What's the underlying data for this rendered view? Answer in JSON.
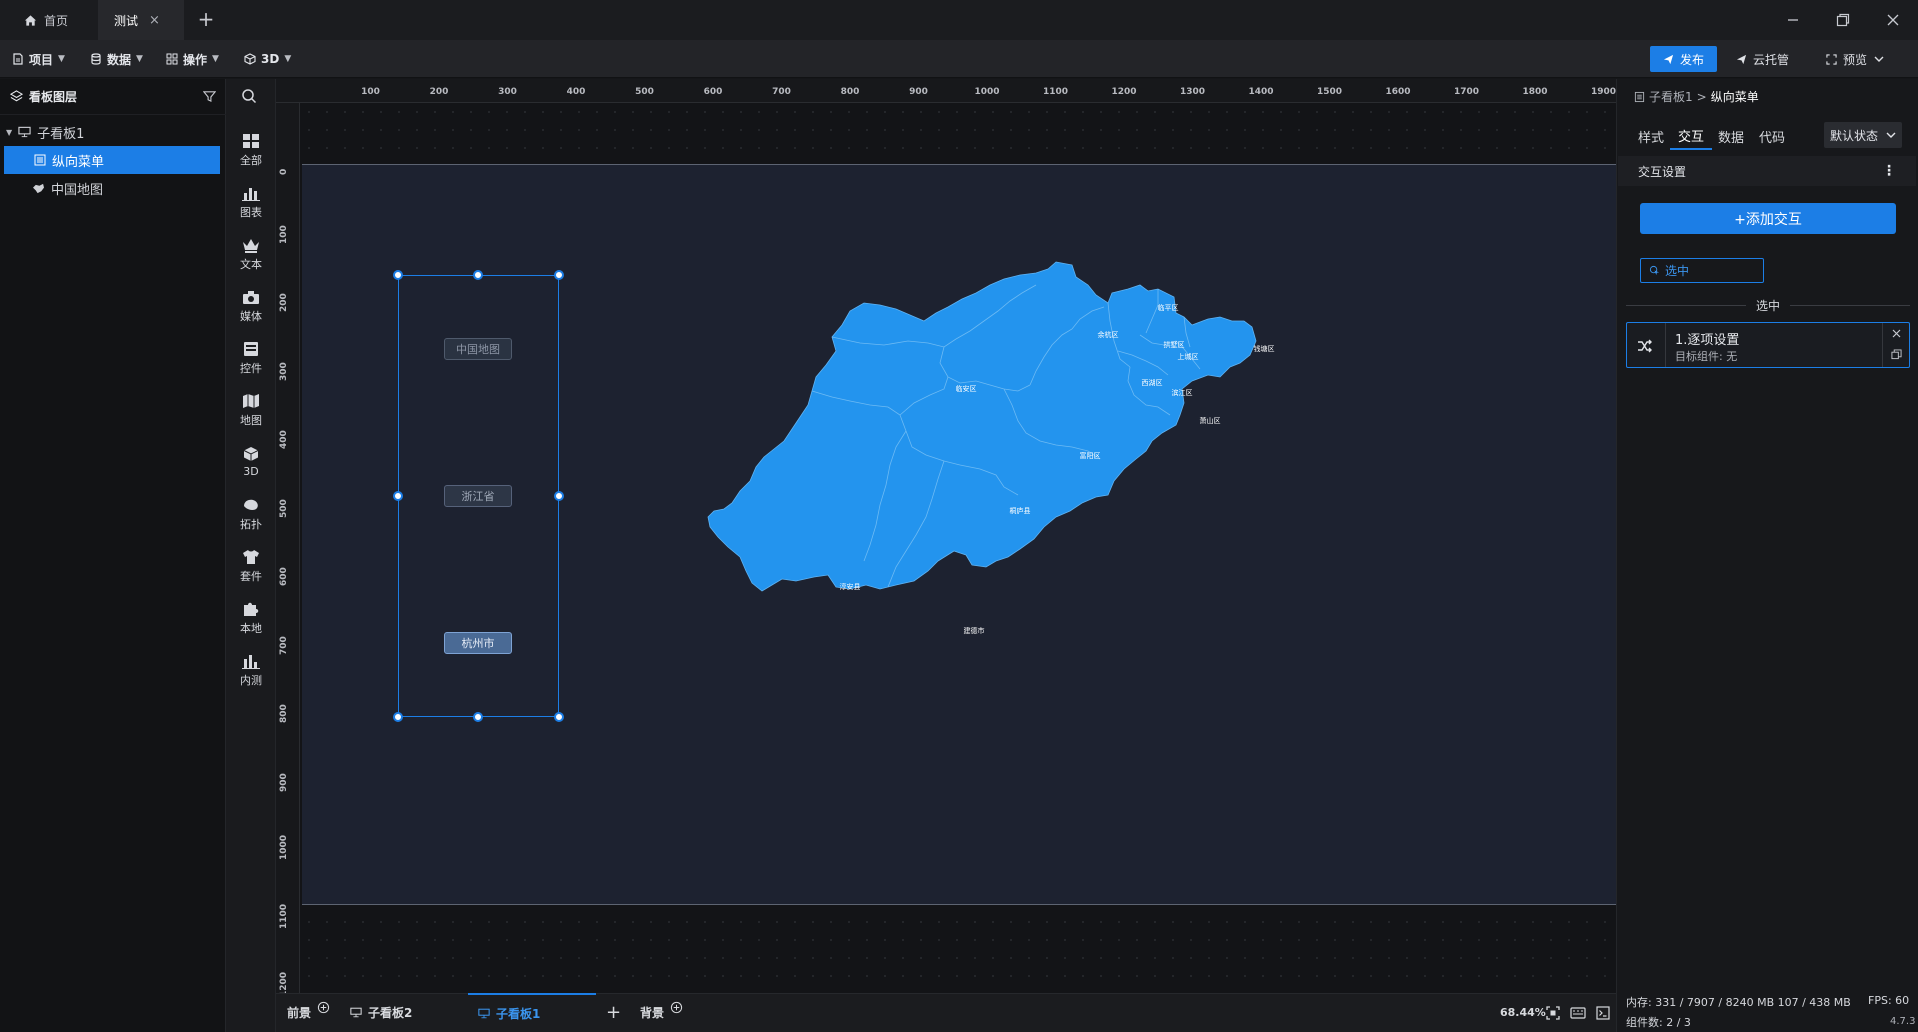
{
  "titlebar": {
    "tabs": [
      {
        "label": "首页"
      },
      {
        "label": "测试"
      }
    ]
  },
  "toolbar": {
    "menus": [
      {
        "label": "项目"
      },
      {
        "label": "数据"
      },
      {
        "label": "操作"
      },
      {
        "label": "3D"
      }
    ],
    "publish": "发布",
    "cloud": "云托管",
    "preview": "预览"
  },
  "layers": {
    "title": "看板图层",
    "items": [
      {
        "label": "子看板1"
      },
      {
        "label": "纵向菜单"
      },
      {
        "label": "中国地图"
      }
    ]
  },
  "iconbar": {
    "items": [
      {
        "label": "全部",
        "icon": "grid-icon"
      },
      {
        "label": "图表",
        "icon": "bar-chart-icon"
      },
      {
        "label": "文本",
        "icon": "crown-icon"
      },
      {
        "label": "媒体",
        "icon": "camera-icon"
      },
      {
        "label": "控件",
        "icon": "widget-icon"
      },
      {
        "label": "地图",
        "icon": "map-icon"
      },
      {
        "label": "3D",
        "icon": "cube-icon"
      },
      {
        "label": "拓扑",
        "icon": "topology-icon"
      },
      {
        "label": "套件",
        "icon": "shirt-icon"
      },
      {
        "label": "本地",
        "icon": "puzzle-icon"
      },
      {
        "label": "内测",
        "icon": "beta-chart-icon"
      }
    ]
  },
  "rulers": {
    "top": [
      "100",
      "200",
      "300",
      "400",
      "500",
      "600",
      "700",
      "800",
      "900",
      "1000",
      "1100",
      "1200",
      "1300",
      "1400",
      "1500",
      "1600",
      "1700",
      "1800",
      "1900"
    ],
    "left": [
      "0",
      "100",
      "200",
      "300",
      "400",
      "500",
      "600",
      "700",
      "800",
      "900",
      "1000",
      "1100",
      "1200"
    ]
  },
  "canvas": {
    "menu_buttons": [
      "中国地图",
      "浙江省",
      "杭州市"
    ],
    "districts": [
      "临平区",
      "余杭区",
      "临安区",
      "钱塘区",
      "拱墅区",
      "上城区",
      "西湖区",
      "滨江区",
      "萧山区",
      "富阳区",
      "桐庐县",
      "淳安县",
      "建德市"
    ]
  },
  "bottom": {
    "foreground": "前景",
    "board2": "子看板2",
    "board1": "子看板1",
    "background": "背景",
    "zoom": "68.44%"
  },
  "rpanel": {
    "breadcrumb_parent": "子看板1",
    "breadcrumb_sep": ">",
    "breadcrumb_current": "纵向菜单",
    "tabs": [
      "样式",
      "交互",
      "数据",
      "代码"
    ],
    "state_select": "默认状态",
    "section_title": "交互设置",
    "add_button": "+添加交互",
    "trigger_chip": "选中",
    "divider_label": "选中",
    "item_title": "1.逐项设置",
    "item_sub": "目标组件: 无",
    "memory": "内存:  331 / 7907 / 8240 MB  107 / 438 MB",
    "fps": "FPS:  60",
    "components": "组件数: 2 / 3",
    "version": "4.7.3"
  },
  "colors": {
    "accent": "#1c7ee6",
    "map_fill": "#2394ee",
    "board_bg": "#1d2230"
  }
}
